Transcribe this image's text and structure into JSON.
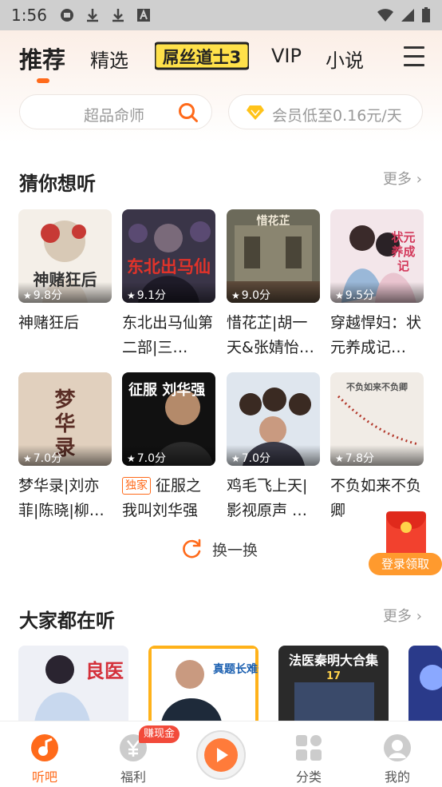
{
  "status_bar": {
    "time": "1:56"
  },
  "top_tabs": [
    {
      "label": "推荐",
      "active": true
    },
    {
      "label": "精选"
    },
    {
      "label": "VIP"
    },
    {
      "label": "小说"
    }
  ],
  "brand_logo_text": "屌丝道士3",
  "search": {
    "placeholder": "超品命师"
  },
  "vip_promo": {
    "text": "会员低至0.16元/天"
  },
  "section_guess": {
    "title": "猜你想听",
    "more": "更多",
    "items": [
      {
        "title": "神赌狂后",
        "rating": "9.8分",
        "cover_text": "神赌狂后"
      },
      {
        "title": "东北出马仙第二部|三…",
        "rating": "9.1分",
        "cover_text": "东北出马仙"
      },
      {
        "title": "惜花芷|胡一天&张婧怡…",
        "rating": "9.0分",
        "cover_text": "惜花芷"
      },
      {
        "title": "穿越悍妇：状元养成记…",
        "rating": "9.5分",
        "cover_text": "状元养成记"
      },
      {
        "title": "梦华录|刘亦菲|陈晓|柳…",
        "rating": "7.0分",
        "cover_text": "梦华录"
      },
      {
        "title": "征服之我叫刘华强",
        "badge": "独家",
        "rating": "7.0分",
        "cover_text": "征服 刘华强"
      },
      {
        "title": "鸡毛飞上天|影视原声 …",
        "rating": "7.0分",
        "cover_text": ""
      },
      {
        "title": "不负如来不负卿",
        "rating": "7.8分",
        "cover_text": "不负如来不负卿"
      }
    ]
  },
  "refresh": {
    "label": "换一换"
  },
  "reward": {
    "label": "登录领取"
  },
  "section_popular": {
    "title": "大家都在听",
    "more": "更多",
    "items": [
      {
        "cover_text": "良医"
      },
      {
        "cover_text": "真题长难句"
      },
      {
        "cover_text": "法医秦明大合集",
        "cover_sub": "17"
      },
      {
        "cover_text": ""
      }
    ]
  },
  "bottom_nav": [
    {
      "label": "听吧",
      "active": true,
      "icon": "music-note-icon"
    },
    {
      "label": "福利",
      "icon": "yen-icon"
    },
    {
      "label": "分类",
      "icon": "grid-icon"
    },
    {
      "label": "我的",
      "icon": "profile-icon"
    }
  ],
  "cash_badge": "赚现金",
  "colors": {
    "accent": "#ff6a1a",
    "reward": "#ff9a2e",
    "badge_red": "#f24a3a"
  }
}
